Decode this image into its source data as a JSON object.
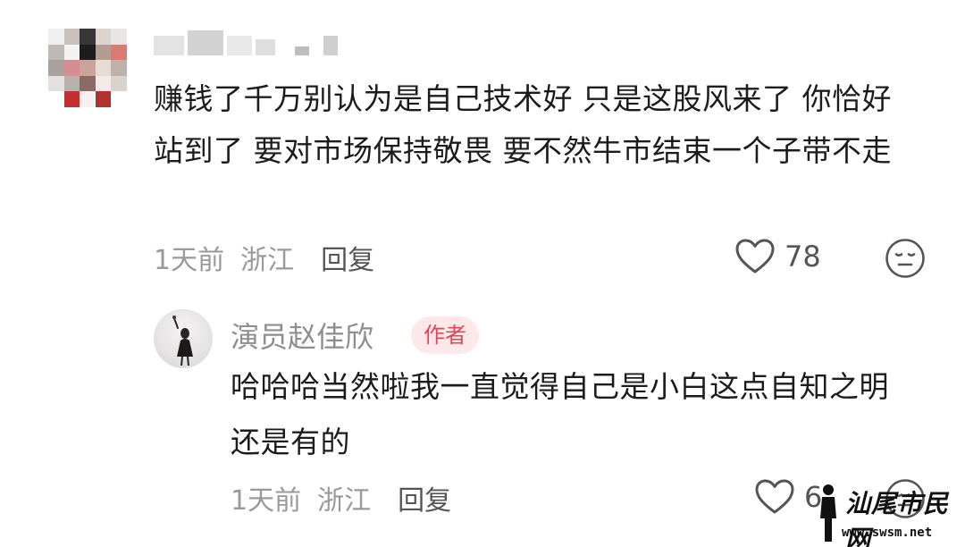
{
  "comment": {
    "text": "赚钱了千万别认为是自己技术好 只是这股风来了 你恰好站到了 要对市场保持敬畏 要不然牛市结束一个子带不走",
    "time": "1天前",
    "location": "浙江",
    "reply_label": "回复",
    "likes": "78",
    "avatar_icon": "pixelated-avatar-icon",
    "username_blurred": true
  },
  "reply": {
    "author": "演员赵佳欣",
    "badge": "作者",
    "badge_color": "#e64456",
    "text": "哈哈哈当然啦我一直觉得自己是小白这点自知之明还是有的",
    "time": "1天前",
    "location": "浙江",
    "reply_label": "回复",
    "likes": "6"
  },
  "icons": {
    "like": "heart-outline-icon",
    "emoji": "neutral-face-icon"
  },
  "watermark": {
    "title": "汕尾市民网",
    "url": "www.swsm.net"
  }
}
